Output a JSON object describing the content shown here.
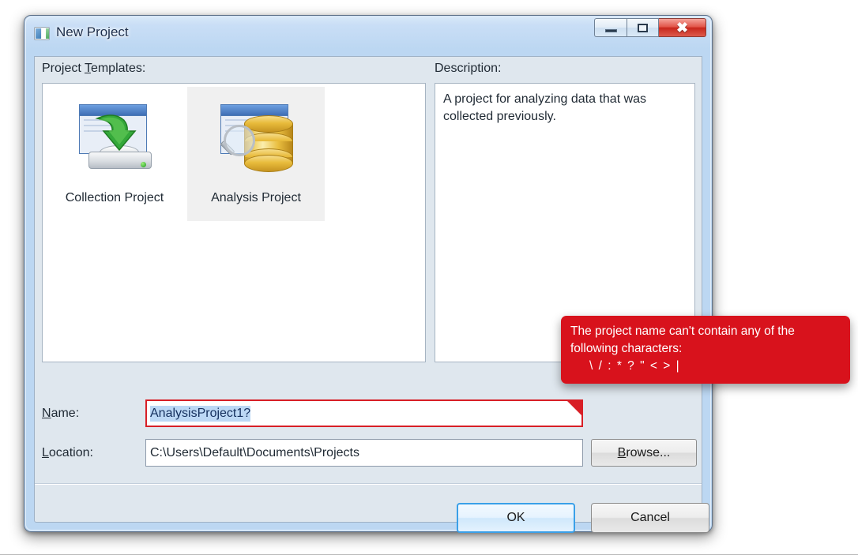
{
  "window": {
    "title": "New Project",
    "icon": "new-project-icon",
    "caption_buttons": {
      "minimize": "–",
      "maximize": "□",
      "close": "✖"
    }
  },
  "templates_section": {
    "label_prefix": "Project ",
    "label_accesskey": "T",
    "label_suffix": "emplates:",
    "items": [
      {
        "label": "Collection Project",
        "icon": "collection-project-icon",
        "selected": false
      },
      {
        "label": "Analysis Project",
        "icon": "analysis-project-icon",
        "selected": true
      }
    ]
  },
  "description_section": {
    "label": "Description:",
    "text": "A project for analyzing data that was collected previously."
  },
  "name_field": {
    "label_accesskey": "N",
    "label_suffix": "ame:",
    "value": "AnalysisProject1?",
    "selected": true,
    "has_error": true,
    "error_color": "#d8121c"
  },
  "location_field": {
    "label_accesskey": "L",
    "label_suffix": "ocation:",
    "value": "C:\\Users\\Default\\Documents\\Projects"
  },
  "browse_button": {
    "accesskey": "B",
    "label_suffix": "rowse..."
  },
  "footer_buttons": {
    "ok": "OK",
    "cancel": "Cancel",
    "default_button": "OK",
    "focus_color": "#3aa0e8"
  },
  "error_tooltip": {
    "line1": "The project name can't contain any of the",
    "line2": "following characters:",
    "characters": "\\ / : * ? \" < > |",
    "background": "#d8121c",
    "text_color": "#ffffff"
  }
}
